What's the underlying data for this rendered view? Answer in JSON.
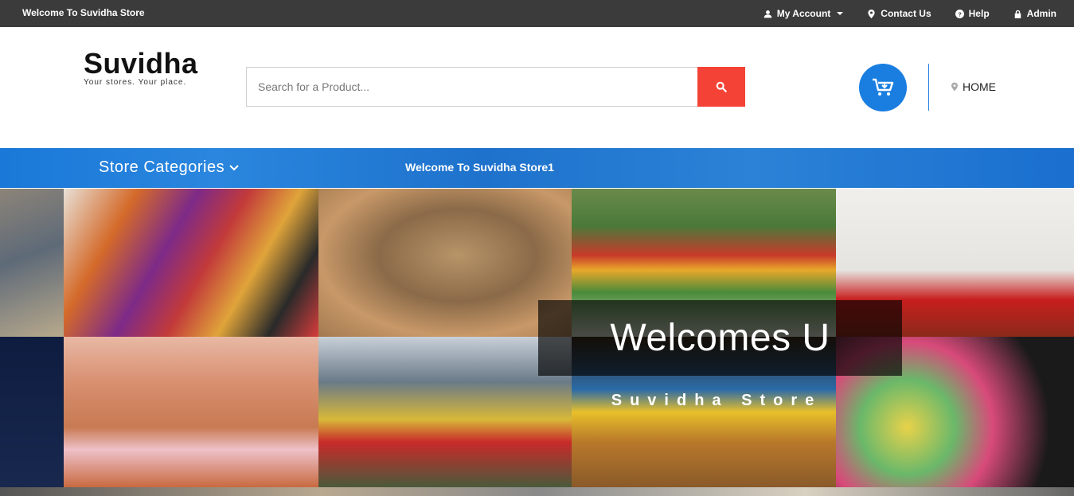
{
  "topbar": {
    "welcome": "Welcome To Suvidha Store",
    "links": {
      "my_account": "My Account",
      "contact": "Contact Us",
      "help": "Help",
      "admin": "Admin"
    }
  },
  "header": {
    "logo_name": "Suvidha",
    "logo_tagline": "Your stores. Your place.",
    "search_placeholder": "Search for a Product...",
    "home_label": "HOME"
  },
  "nav": {
    "categories_label": "Store Categories",
    "welcome_message": "Welcome To Suvidha Store1"
  },
  "hero": {
    "headline": "Welcomes U",
    "subheadline": "Suvidha Store"
  },
  "colors": {
    "topbar": "#3b3b3b",
    "accent_blue": "#1a7ee0",
    "search_button": "#f44336"
  },
  "icons": [
    "user-icon",
    "map-marker-icon",
    "question-circle-icon",
    "lock-icon",
    "search-icon",
    "cart-icon",
    "chevron-down-icon"
  ]
}
